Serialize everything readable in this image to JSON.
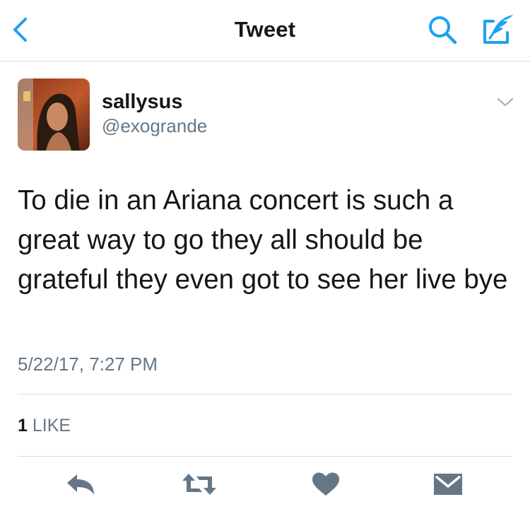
{
  "nav": {
    "title": "Tweet",
    "back_icon": "chevron-left-icon",
    "search_icon": "search-icon",
    "compose_icon": "compose-icon"
  },
  "tweet": {
    "display_name": "sallysus",
    "handle": "@exogrande",
    "text": "To die in an Ariana concert is such a great way to go they all should be grateful they even got to see her live bye",
    "timestamp": "5/22/17, 7:27 PM",
    "like_count": "1",
    "like_label": "LIKE"
  },
  "actions": [
    {
      "name": "reply",
      "icon": "reply-icon"
    },
    {
      "name": "retweet",
      "icon": "retweet-icon"
    },
    {
      "name": "like",
      "icon": "heart-icon"
    },
    {
      "name": "direct-message",
      "icon": "envelope-icon"
    }
  ],
  "colors": {
    "accent": "#1da1f2",
    "text_primary": "#14171a",
    "text_secondary": "#657786",
    "divider": "#d8dde1",
    "icon_gray": "#657786"
  }
}
